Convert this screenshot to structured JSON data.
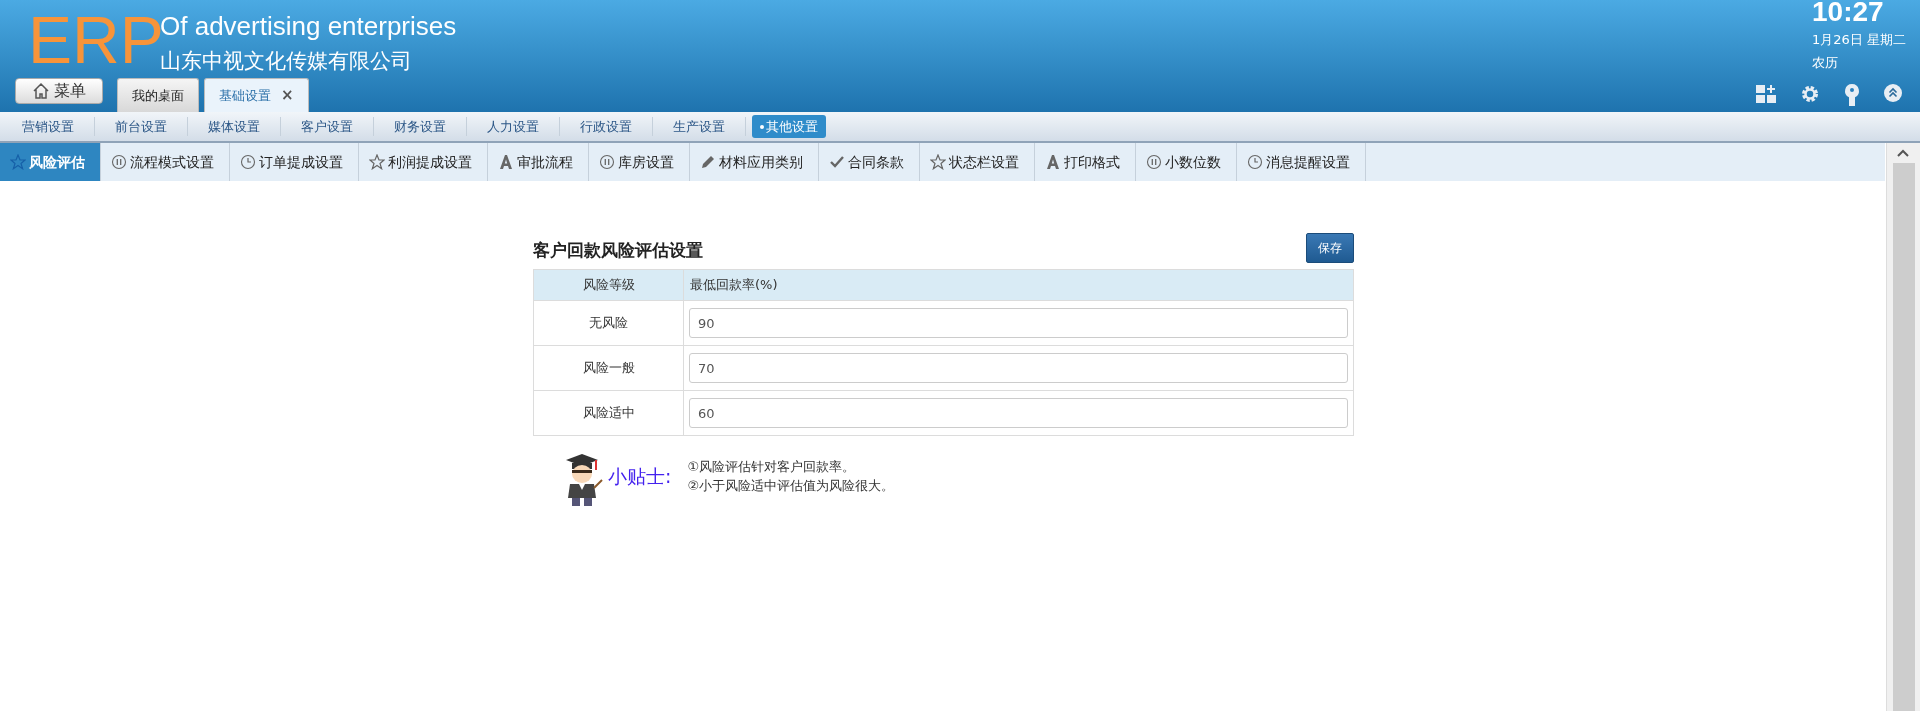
{
  "header": {
    "logo": "ERP",
    "title": "Of advertising enterprises",
    "company": "山东中视文化传媒有限公司",
    "menu_button": "菜单",
    "tabs": [
      {
        "label": "我的桌面",
        "selected": false
      },
      {
        "label": "基础设置",
        "selected": true,
        "close": "×"
      }
    ],
    "clock": {
      "time": "10:27",
      "date": "1月26日 星期二",
      "lunar": "农历"
    }
  },
  "menu": [
    {
      "label": "营销设置",
      "selected": false
    },
    {
      "label": "前台设置",
      "selected": false
    },
    {
      "label": "媒体设置",
      "selected": false
    },
    {
      "label": "客户设置",
      "selected": false
    },
    {
      "label": "财务设置",
      "selected": false
    },
    {
      "label": "人力设置",
      "selected": false
    },
    {
      "label": "行政设置",
      "selected": false
    },
    {
      "label": "生产设置",
      "selected": false
    },
    {
      "label": "其他设置",
      "selected": true
    }
  ],
  "subtabs": [
    {
      "label": "风险评估",
      "kind": "star",
      "selected": true
    },
    {
      "label": "流程模式设置",
      "kind": "pause",
      "selected": false
    },
    {
      "label": "订单提成设置",
      "kind": "clock",
      "selected": false
    },
    {
      "label": "利润提成设置",
      "kind": "star",
      "selected": false
    },
    {
      "label": "审批流程",
      "kind": "letter",
      "selected": false
    },
    {
      "label": "库房设置",
      "kind": "pause",
      "selected": false
    },
    {
      "label": "材料应用类别",
      "kind": "pencil",
      "selected": false
    },
    {
      "label": "合同条款",
      "kind": "check",
      "selected": false
    },
    {
      "label": "状态栏设置",
      "kind": "star",
      "selected": false
    },
    {
      "label": "打印格式",
      "kind": "letter",
      "selected": false
    },
    {
      "label": "小数位数",
      "kind": "pause",
      "selected": false
    },
    {
      "label": "消息提醒设置",
      "kind": "clock",
      "selected": false
    }
  ],
  "panel": {
    "title": "客户回款风险评估设置",
    "save_button": "保存",
    "table": {
      "columns": [
        "风险等级",
        "最低回款率(%)"
      ],
      "rows": [
        {
          "level": "无风险",
          "value": "90"
        },
        {
          "level": "风险一般",
          "value": "70"
        },
        {
          "level": "风险适中",
          "value": "60"
        }
      ]
    },
    "tips": {
      "heading": "小贴士:",
      "notes": [
        "①风险评估针对客户回款率。",
        "②小于风险适中评估值为风险很大。"
      ]
    }
  }
}
